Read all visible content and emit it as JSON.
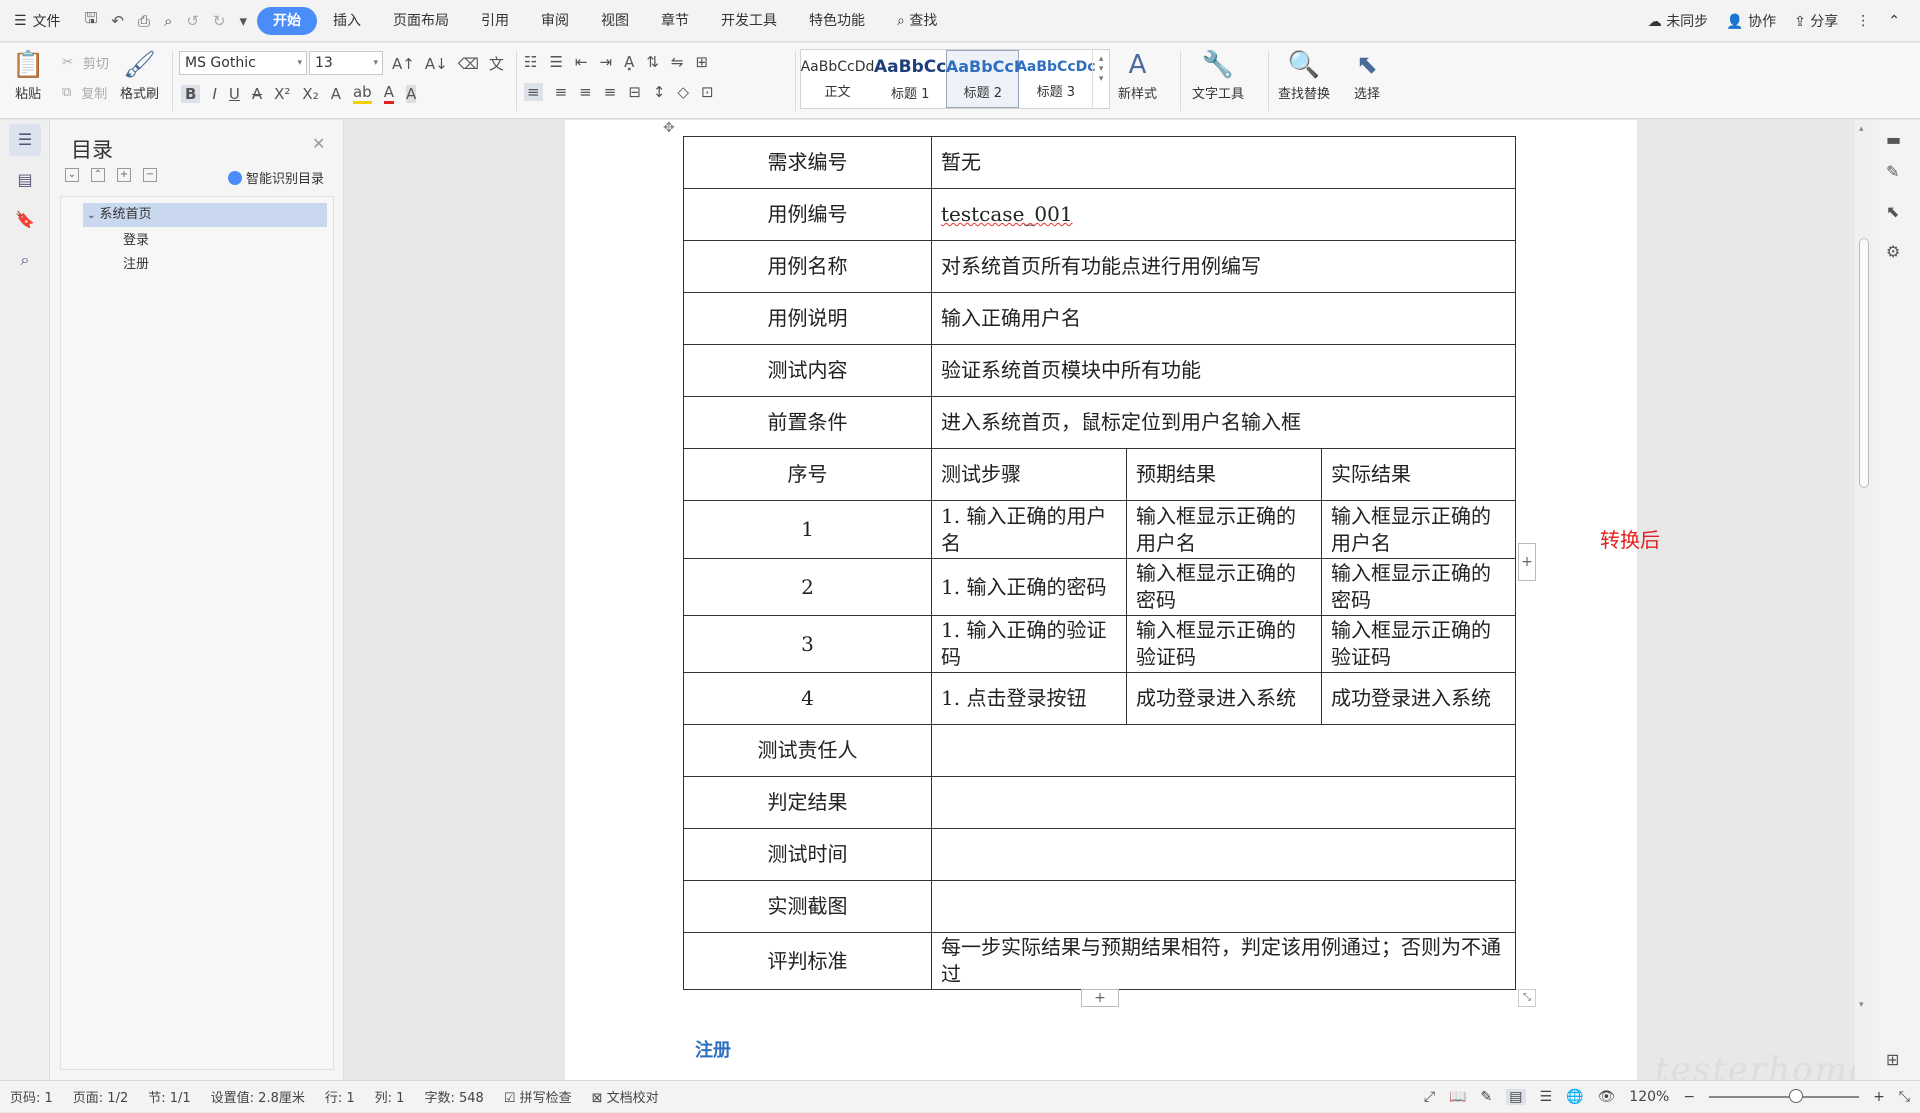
{
  "topbar": {
    "file_label": "文件",
    "tabs": [
      "开始",
      "插入",
      "页面布局",
      "引用",
      "审阅",
      "视图",
      "章节",
      "开发工具",
      "特色功能"
    ],
    "search_label": "查找",
    "right": [
      "未同步",
      "协作",
      "分享"
    ]
  },
  "ribbon": {
    "paste": "粘贴",
    "cut": "剪切",
    "copy": "复制",
    "format_painter": "格式刷",
    "font_name": "MS Gothic",
    "font_size": "13",
    "styles": [
      {
        "preview": "AaBbCcDd",
        "name": "正文"
      },
      {
        "preview": "AaBbCc",
        "name": "标题 1"
      },
      {
        "preview": "AaBbCcI",
        "name": "标题 2"
      },
      {
        "preview": "AaBbCcDc",
        "name": "标题 3"
      }
    ],
    "new_style": "新样式",
    "text_tools": "文字工具",
    "find_replace": "查找替换",
    "select": "选择"
  },
  "toc": {
    "title": "目录",
    "smart": "智能识别目录",
    "items": [
      "系统首页",
      "登录",
      "注册"
    ]
  },
  "table": {
    "rows_top": [
      [
        "需求编号",
        "暂无"
      ],
      [
        "用例编号",
        "testcase_001"
      ],
      [
        "用例名称",
        "对系统首页所有功能点进行用例编写"
      ],
      [
        "用例说明",
        "输入正确用户名"
      ],
      [
        "测试内容",
        "验证系统首页模块中所有功能"
      ],
      [
        "前置条件",
        "进入系统首页，鼠标定位到用户名输入框"
      ]
    ],
    "step_header": [
      "序号",
      "测试步骤",
      "预期结果",
      "实际结果"
    ],
    "steps": [
      [
        "1",
        "1.  输入正确的用户名",
        "输入框显示正确的用户名",
        "输入框显示正确的用户名"
      ],
      [
        "2",
        "1.  输入正确的密码",
        "输入框显示正确的密码",
        "输入框显示正确的密码"
      ],
      [
        "3",
        "1.  输入正确的验证码",
        "输入框显示正确的验证码",
        "输入框显示正确的验证码"
      ],
      [
        "4",
        "1.  点击登录按钮",
        "成功登录进入系统",
        "成功登录进入系统"
      ]
    ],
    "rows_bottom": [
      [
        "测试责任人",
        ""
      ],
      [
        "判定结果",
        ""
      ],
      [
        "测试时间",
        ""
      ],
      [
        "实测截图",
        ""
      ],
      [
        "评判标准",
        "每一步实际结果与预期结果相符，判定该用例通过；否则为不通过"
      ]
    ]
  },
  "note": "转换后",
  "next_heading": "注册",
  "watermark": "testerhome.com",
  "status": {
    "page_code": "页码: 1",
    "page": "页面: 1/2",
    "section": "节: 1/1",
    "setting": "设置值: 2.8厘米",
    "row": "行: 1",
    "col": "列: 1",
    "words": "字数: 548",
    "spell": "拼写检查",
    "proof": "文档校对",
    "zoom": "120%"
  }
}
